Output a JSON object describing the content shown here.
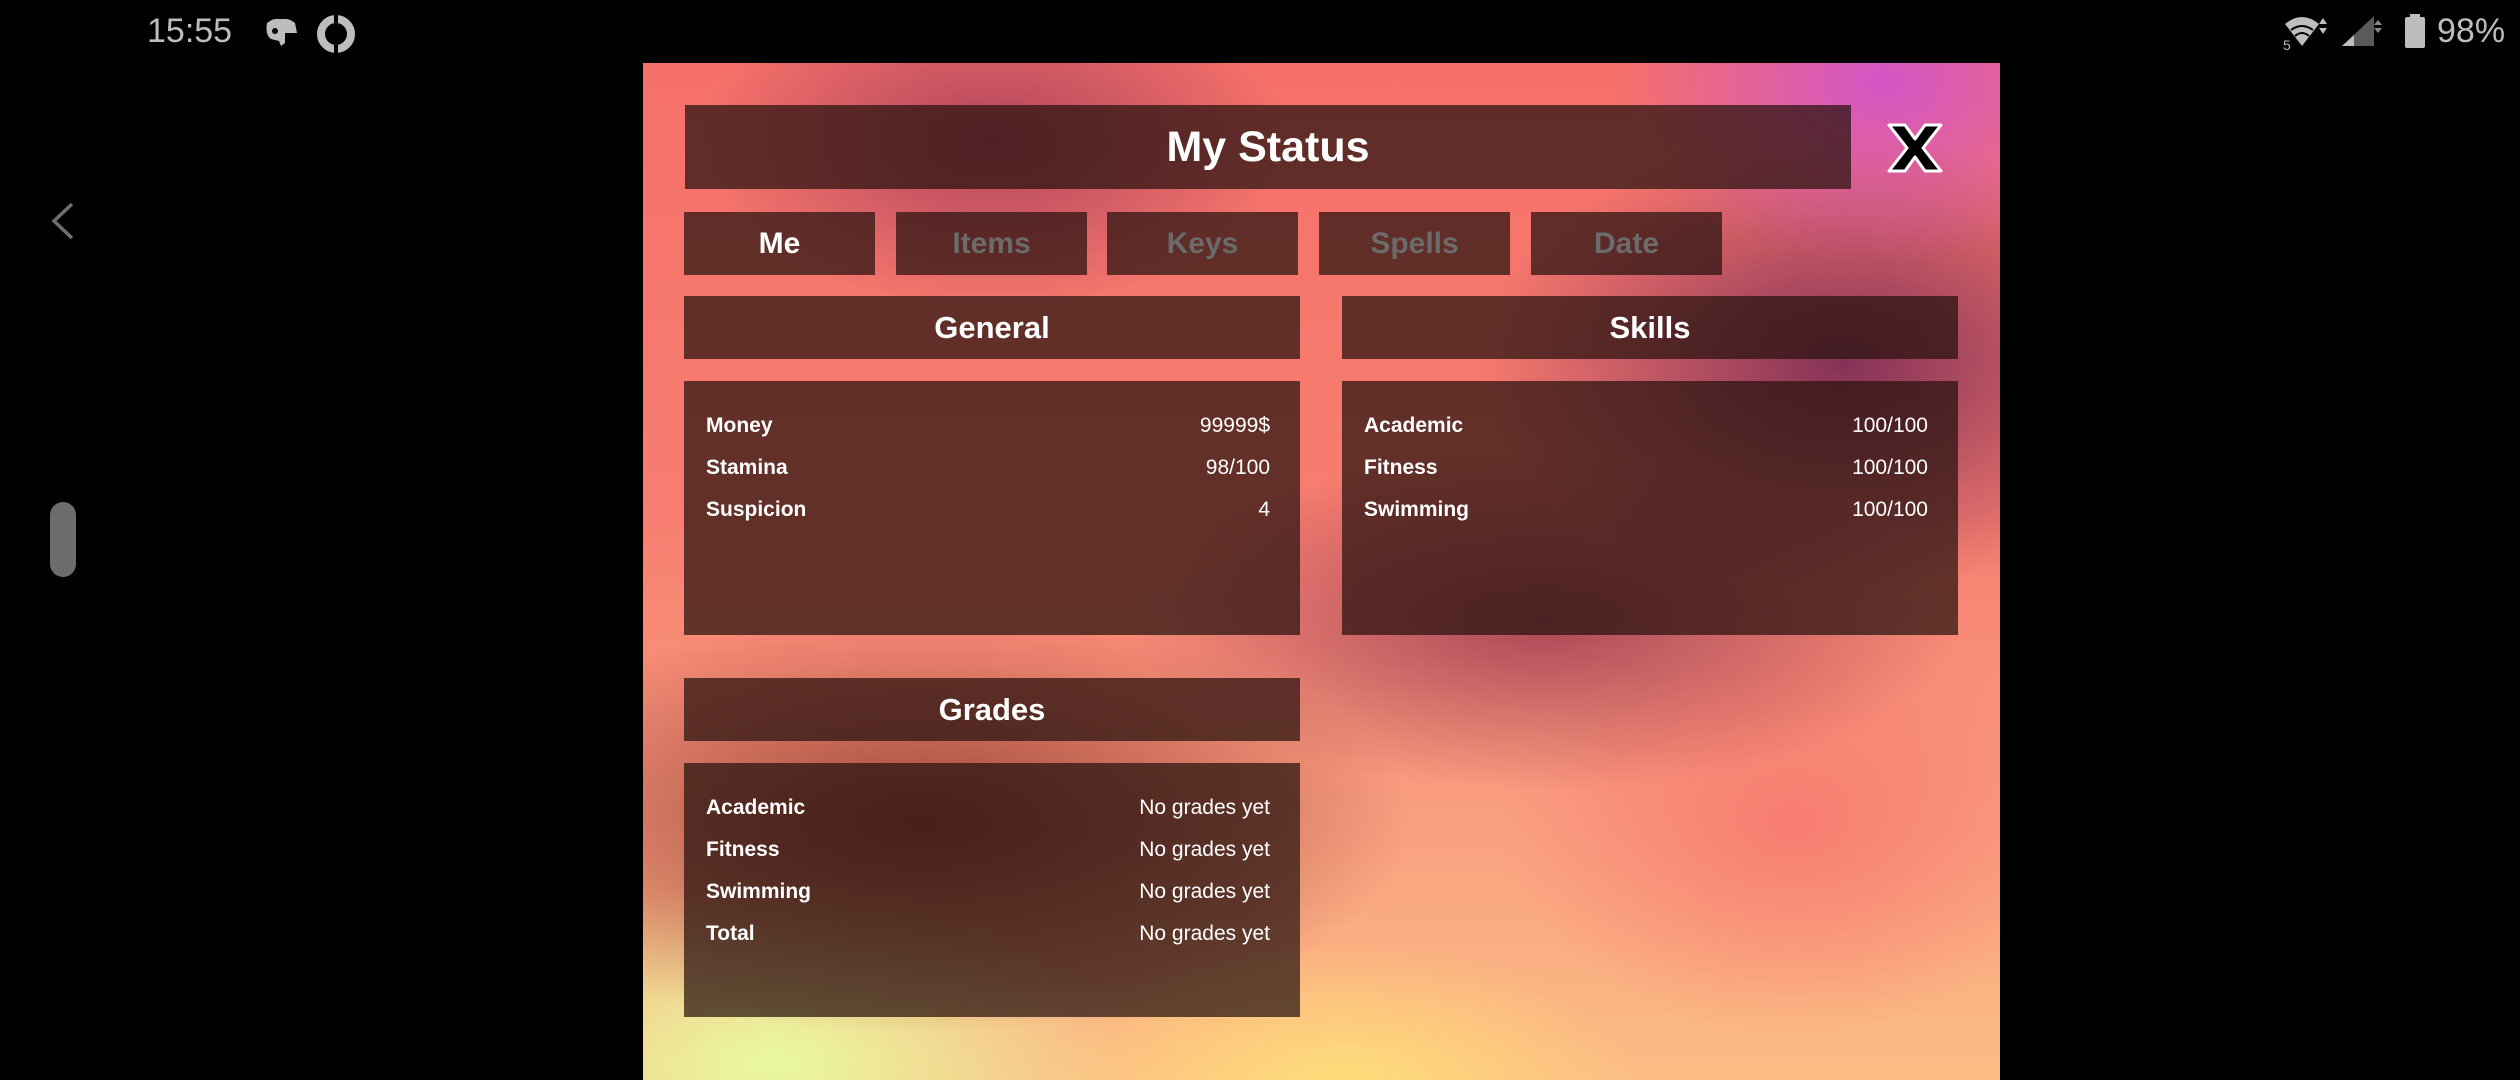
{
  "status_bar": {
    "time": "15:55",
    "left_icons": [
      "discord-icon",
      "sync-circle-icon"
    ],
    "right_icons": [
      "wifi-5-icon",
      "cell-signal-icon",
      "battery-icon"
    ],
    "battery_percent": "98%"
  },
  "nav": {
    "back_icon": "back-chevron-icon",
    "handle": "side-panel-handle"
  },
  "window": {
    "title": "My Status",
    "close_icon": "close-x-icon"
  },
  "tabs": [
    {
      "label": "Me",
      "active": true
    },
    {
      "label": "Items",
      "active": false
    },
    {
      "label": "Keys",
      "active": false
    },
    {
      "label": "Spells",
      "active": false
    },
    {
      "label": "Date",
      "active": false
    }
  ],
  "general": {
    "title": "General",
    "rows": [
      {
        "label": "Money",
        "value": "99999$"
      },
      {
        "label": "Stamina",
        "value": "98/100"
      },
      {
        "label": "Suspicion",
        "value": "4"
      }
    ]
  },
  "skills": {
    "title": "Skills",
    "rows": [
      {
        "label": "Academic",
        "value": "100/100"
      },
      {
        "label": "Fitness",
        "value": "100/100"
      },
      {
        "label": "Swimming",
        "value": "100/100"
      }
    ]
  },
  "grades": {
    "title": "Grades",
    "rows": [
      {
        "label": "Academic",
        "value": "No grades yet"
      },
      {
        "label": "Fitness",
        "value": "No grades yet"
      },
      {
        "label": "Swimming",
        "value": "No grades yet"
      },
      {
        "label": "Total",
        "value": "No grades yet"
      }
    ]
  },
  "colors": {
    "panel_bg": "#2a120e",
    "tab_inactive_text": "#6b6b6b",
    "text": "#ffffff",
    "status_text": "#bdbdbd"
  }
}
